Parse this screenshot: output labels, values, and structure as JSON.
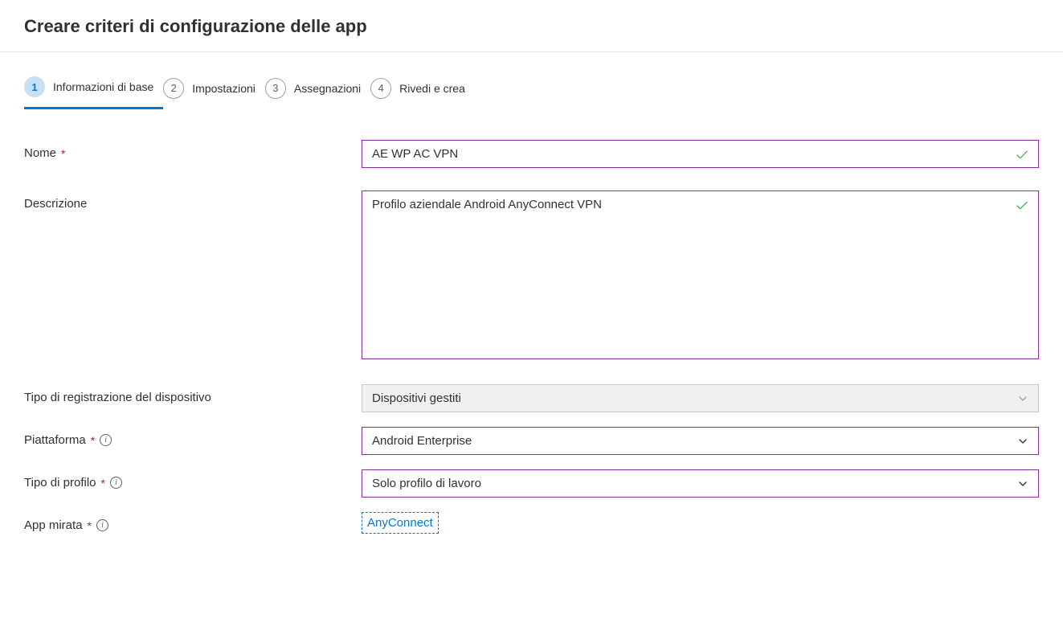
{
  "header": {
    "title": "Creare criteri di configurazione delle app"
  },
  "steps": [
    {
      "num": "1",
      "label": "Informazioni di base"
    },
    {
      "num": "2",
      "label": "Impostazioni"
    },
    {
      "num": "3",
      "label": "Assegnazioni"
    },
    {
      "num": "4",
      "label": "Rivedi e crea"
    }
  ],
  "form": {
    "name_label": "Nome",
    "name_value": "AE WP AC VPN",
    "desc_label": "Descrizione",
    "desc_value": "Profilo aziendale Android AnyConnect VPN",
    "enrollment_label": "Tipo di registrazione del dispositivo",
    "enrollment_value": "Dispositivi gestiti",
    "platform_label": "Piattaforma",
    "platform_value": "Android Enterprise",
    "profile_type_label": "Tipo di profilo",
    "profile_type_value": "Solo profilo di lavoro",
    "targeted_app_label": "App mirata",
    "targeted_app_value": "AnyConnect"
  }
}
